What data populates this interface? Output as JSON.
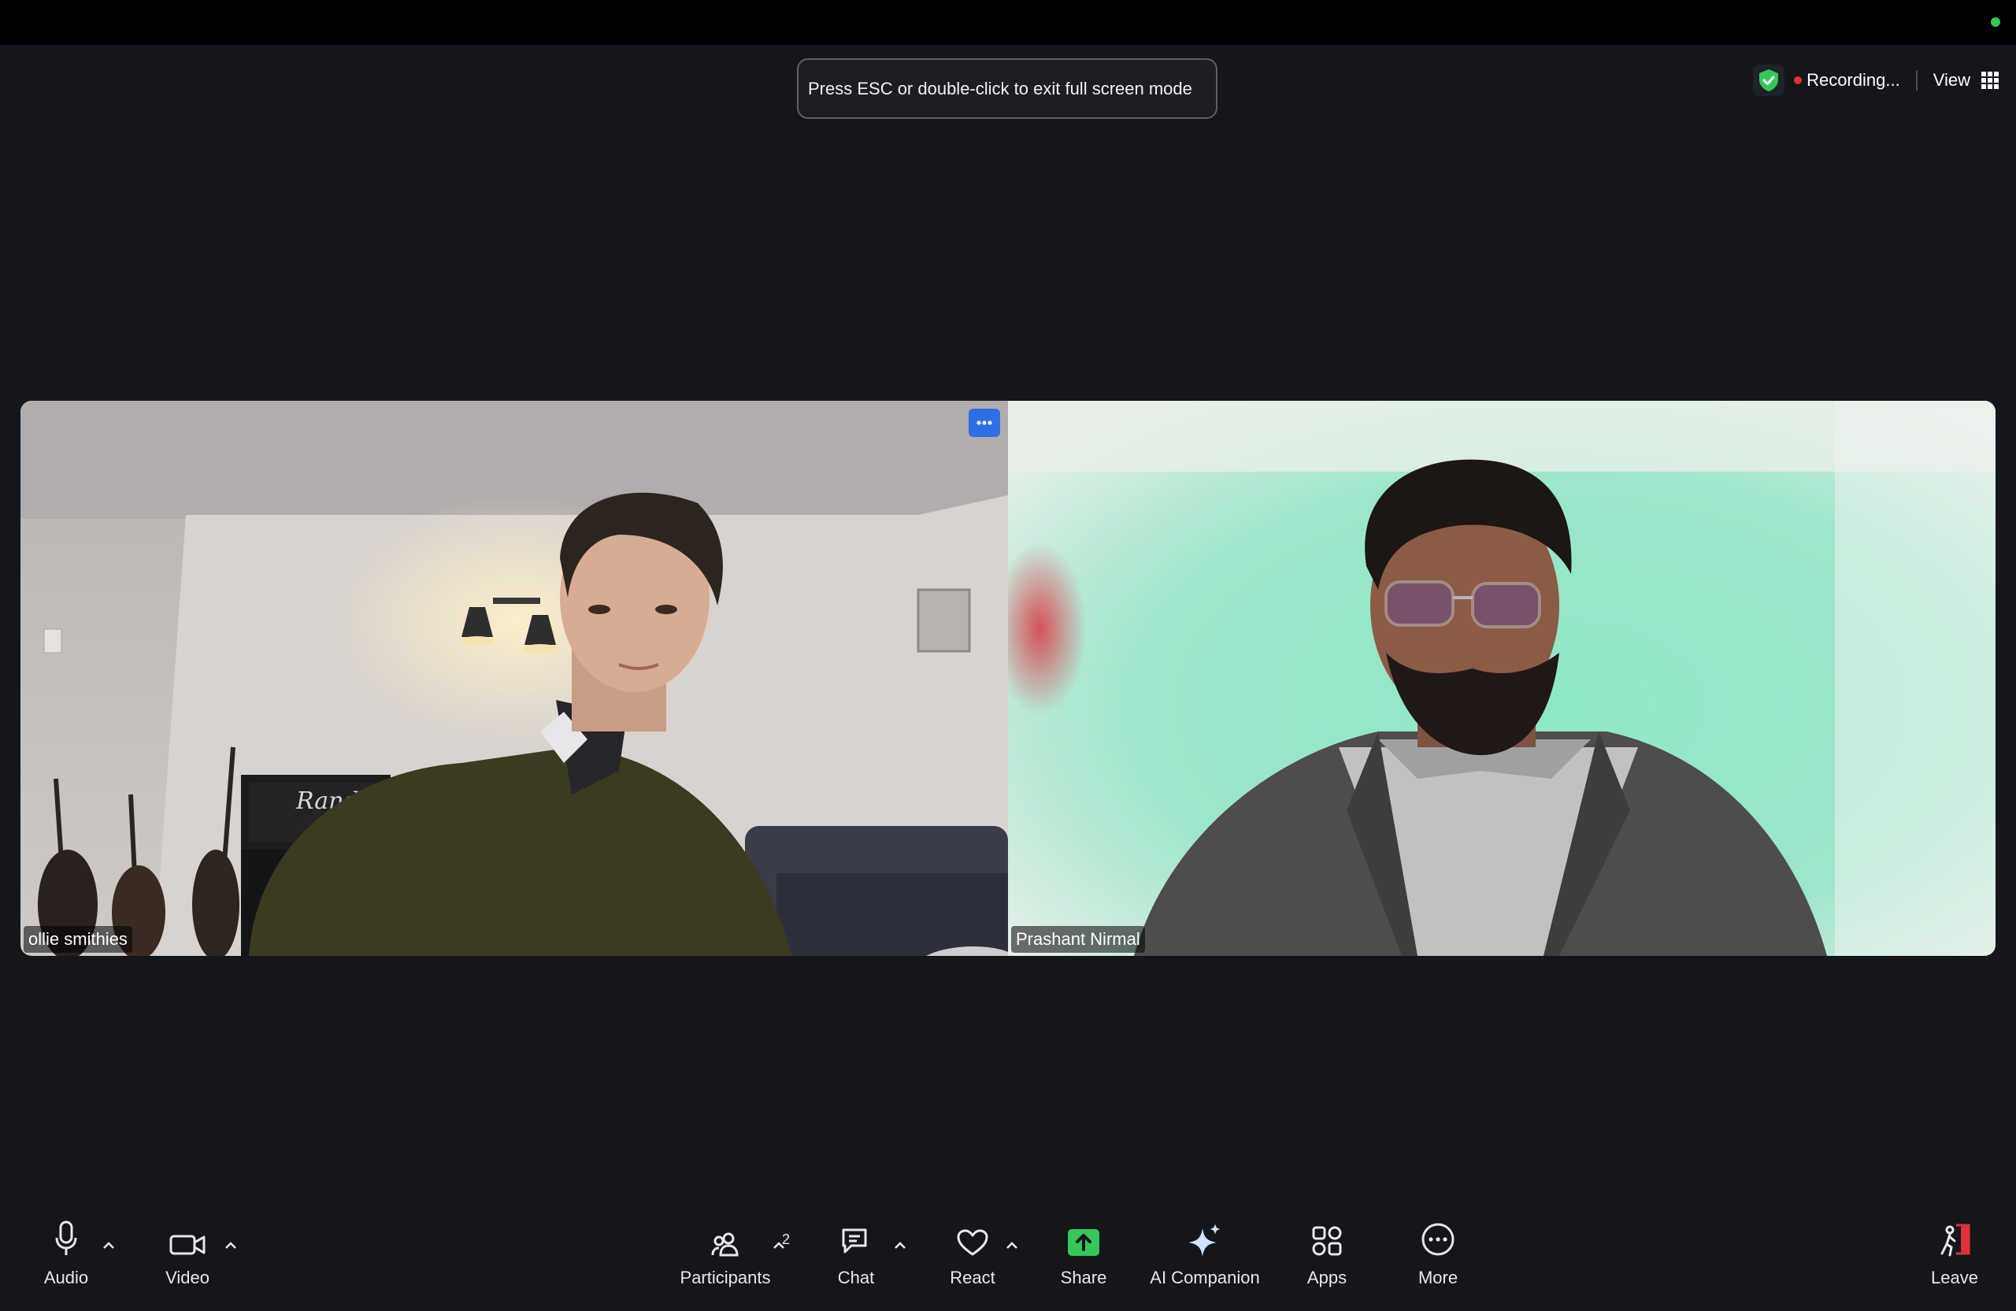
{
  "toast": {
    "text": "Press ESC or double-click to exit full screen mode"
  },
  "status": {
    "recording": "Recording...",
    "view": "View"
  },
  "participants": [
    {
      "name": "ollie smithies"
    },
    {
      "name": "Prashant Nirmal"
    }
  ],
  "amp_text": "Rando",
  "toolbar": {
    "audio": "Audio",
    "video": "Video",
    "participants": "Participants",
    "participants_count": "2",
    "chat": "Chat",
    "react": "React",
    "share": "Share",
    "ai_companion": "AI Companion",
    "apps": "Apps",
    "more": "More",
    "leave": "Leave"
  },
  "colors": {
    "accent_blue": "#2f6fe5",
    "share_green": "#35c759",
    "recording_red": "#e0303a",
    "leave_red": "#e0303a"
  }
}
